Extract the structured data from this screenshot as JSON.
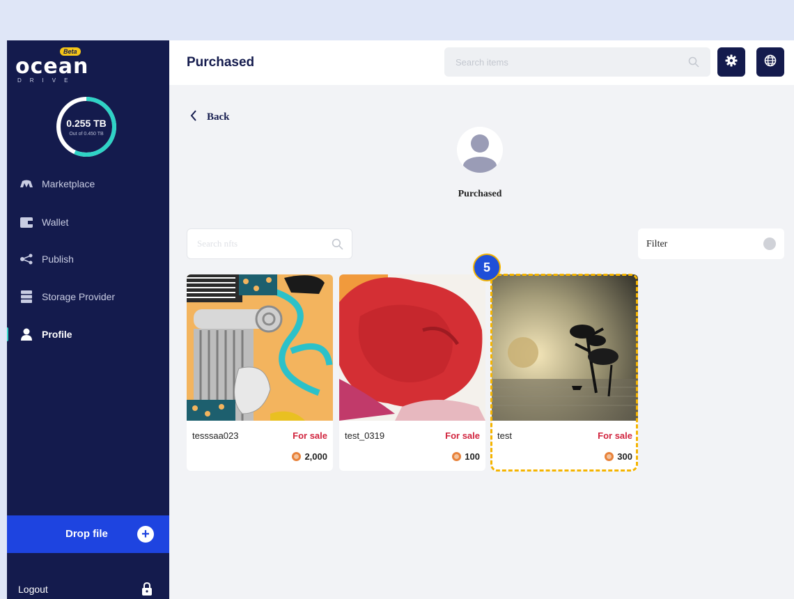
{
  "app": {
    "logo_word": "ocean",
    "logo_beta": "Beta",
    "logo_sub": "DRIVE"
  },
  "storage": {
    "used": "0.255 TB",
    "total": "Out of 0.450 TB",
    "used_fraction": 0.567
  },
  "sidebar": {
    "items": [
      {
        "label": "Marketplace",
        "icon": "marketplace-icon"
      },
      {
        "label": "Wallet",
        "icon": "wallet-icon"
      },
      {
        "label": "Publish",
        "icon": "share-icon"
      },
      {
        "label": "Storage Provider",
        "icon": "server-icon"
      },
      {
        "label": "Profile",
        "icon": "user-icon",
        "active": true
      }
    ],
    "drop_file": "Drop file",
    "logout": "Logout"
  },
  "header": {
    "title": "Purchased",
    "search_placeholder": "Search items"
  },
  "main": {
    "back_label": "Back",
    "profile_name": "Purchased",
    "search_placeholder": "Search nfts",
    "filter_label": "Filter",
    "cards": [
      {
        "name": "tesssaa023",
        "status": "For sale",
        "price": "2,000"
      },
      {
        "name": "test_0319",
        "status": "For sale",
        "price": "100"
      },
      {
        "name": "test",
        "status": "For sale",
        "price": "300"
      }
    ]
  },
  "annotation": {
    "step": "5"
  },
  "colors": {
    "sidebar_bg": "#141b4d",
    "accent_blue": "#1e44e0",
    "teal": "#2fd3c6",
    "sale_red": "#d1243e",
    "highlight": "#f5b400"
  }
}
